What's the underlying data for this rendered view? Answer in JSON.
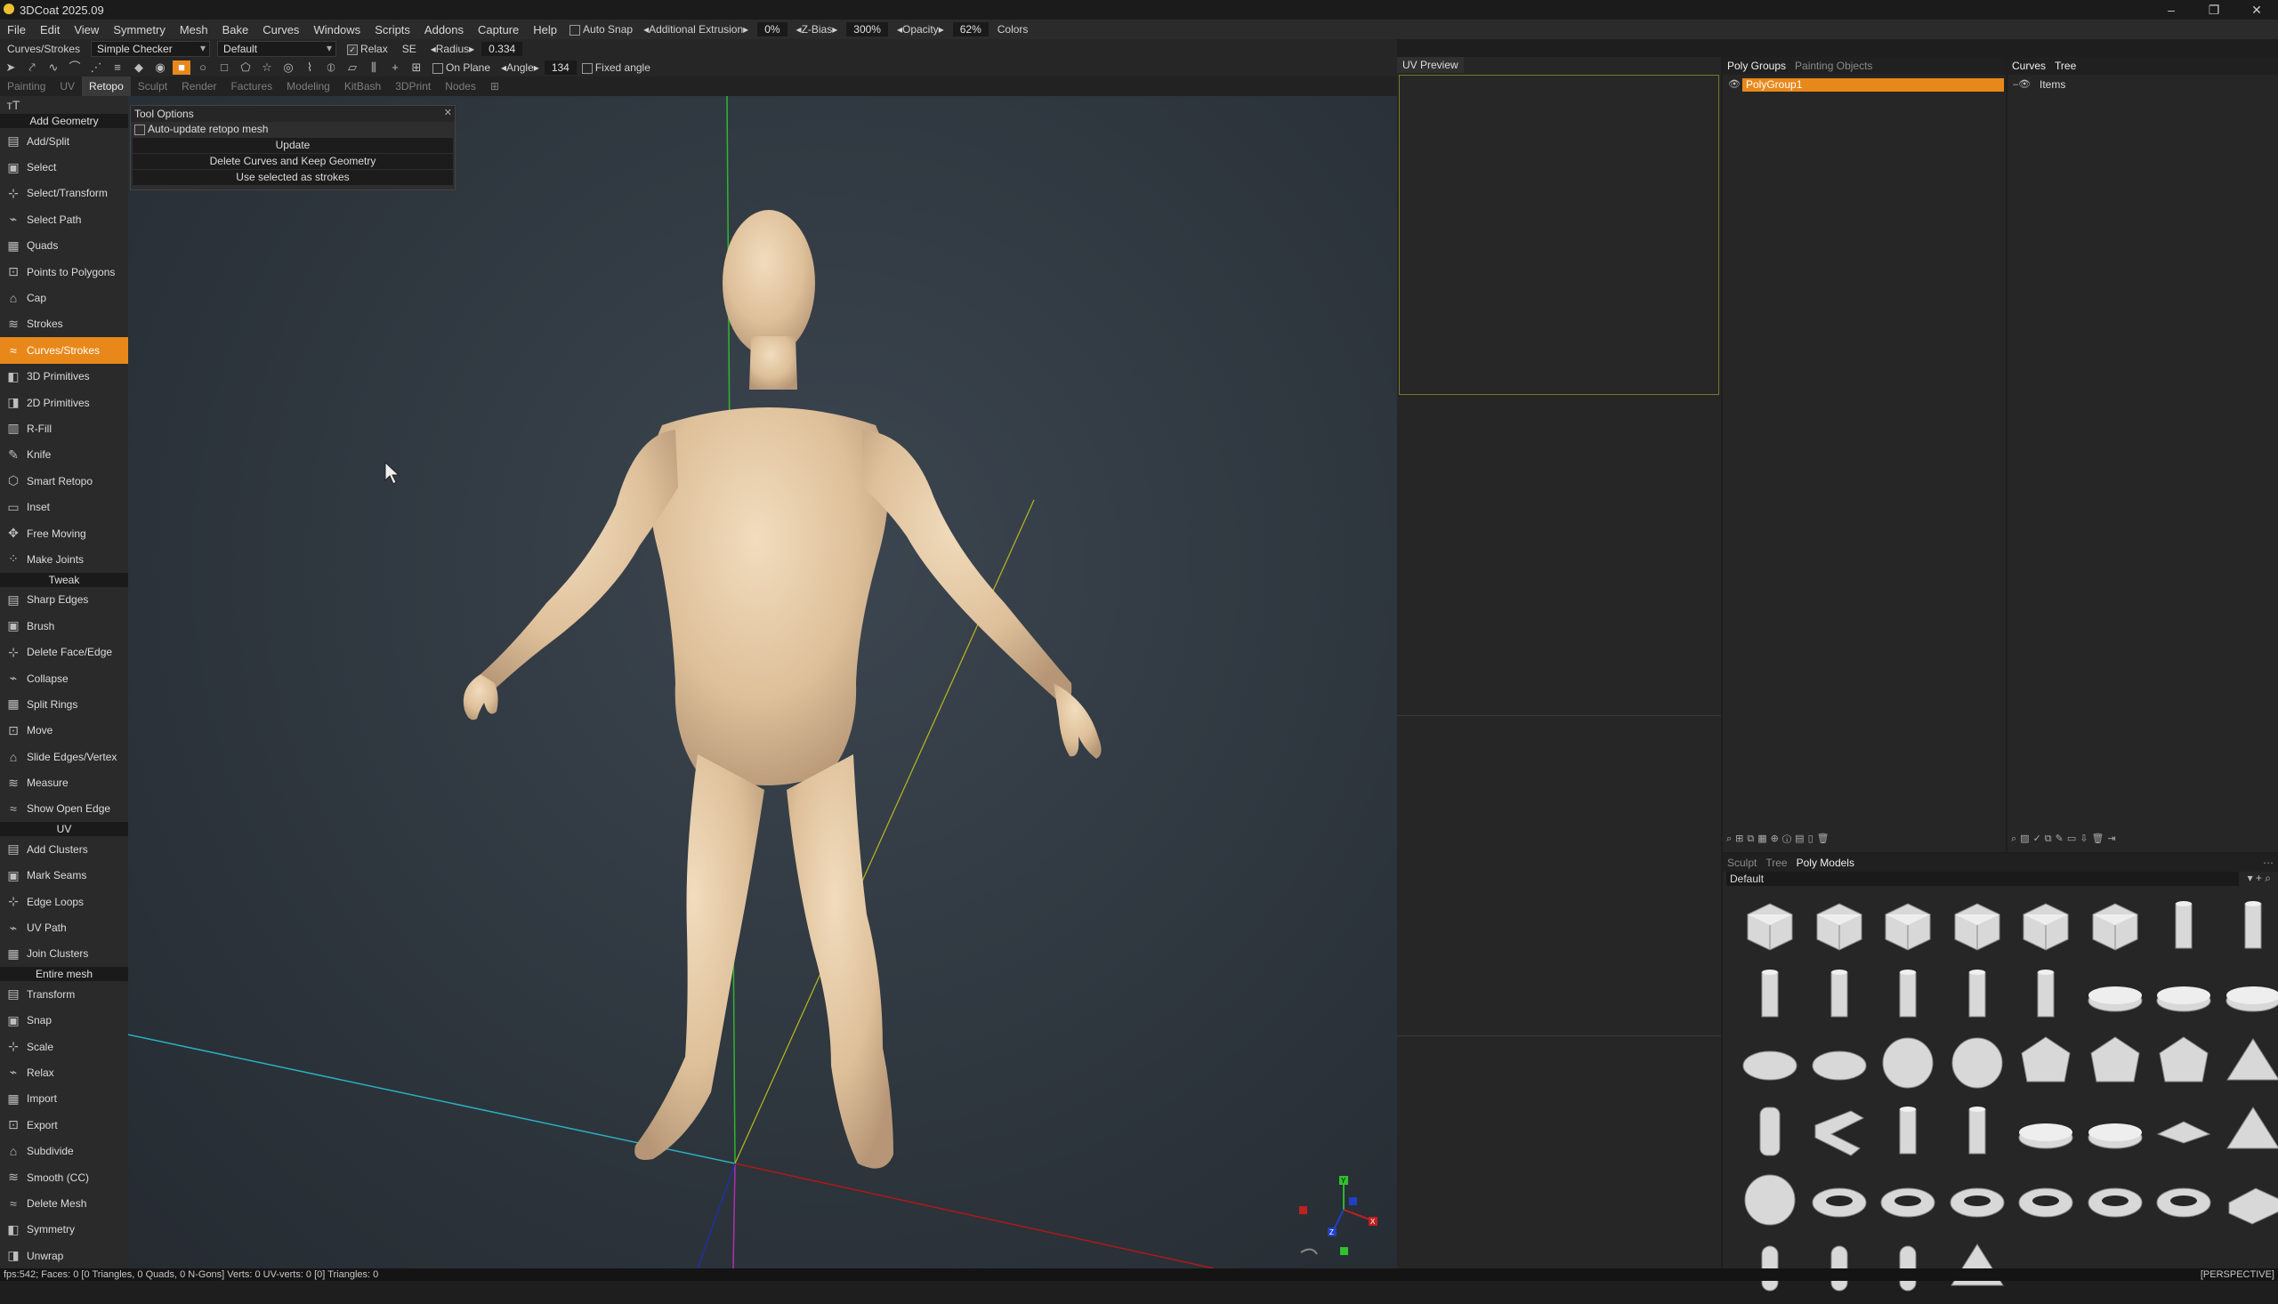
{
  "window": {
    "title": "3DCoat 2025.09",
    "controls": [
      "–",
      "❐",
      "✕"
    ]
  },
  "menu": [
    "File",
    "Edit",
    "View",
    "Symmetry",
    "Mesh",
    "Bake",
    "Curves",
    "Windows",
    "Scripts",
    "Addons",
    "Capture",
    "Help"
  ],
  "menu_controls": {
    "auto_snap": "Auto Snap",
    "additional_extrusion": "Additional Extrusion",
    "extrusion_value": "0%",
    "zbias": "Z-Bias",
    "zbias_value": "300%",
    "opacity": "Opacity",
    "opacity_value": "62%",
    "colors": "Colors"
  },
  "option_bar": {
    "tool": "Curves/Strokes",
    "material": "Simple Checker",
    "preset": "Default",
    "relax": "Relax",
    "se": "SE",
    "radius": "Radius",
    "radius_value": "0.334"
  },
  "icon_bar": {
    "on_plane": "On Plane",
    "angle": "Angle",
    "angle_value": "134",
    "fixed_angle": "Fixed angle"
  },
  "rooms": [
    "Painting",
    "UV",
    "Retopo",
    "Sculpt",
    "Render",
    "Factures",
    "Modeling",
    "KitBash",
    "3DPrint",
    "Nodes"
  ],
  "active_room": "Retopo",
  "left_tools": {
    "sections": {
      "add_geometry": "Add Geometry",
      "tweak": "Tweak",
      "uv": "UV",
      "entire_mesh": "Entire mesh"
    },
    "add_geometry": [
      {
        "label": "Add/Split",
        "icon": "add-split-icon"
      },
      {
        "label": "Select",
        "icon": "select-icon"
      },
      {
        "label": "Select/Transform",
        "icon": "select-transform-icon"
      },
      {
        "label": "Select Path",
        "icon": "select-path-icon"
      },
      {
        "label": "Quads",
        "icon": "quads-icon"
      },
      {
        "label": "Points to Polygons",
        "icon": "points-to-polygons-icon"
      },
      {
        "label": "Cap",
        "icon": "cap-icon"
      },
      {
        "label": "Strokes",
        "icon": "strokes-icon"
      },
      {
        "label": "Curves/Strokes",
        "icon": "curves-strokes-icon",
        "active": true
      },
      {
        "label": "3D Primitives",
        "icon": "primitives-3d-icon"
      },
      {
        "label": "2D Primitives",
        "icon": "primitives-2d-icon"
      },
      {
        "label": "R-Fill",
        "icon": "r-fill-icon"
      },
      {
        "label": "Knife",
        "icon": "knife-icon"
      },
      {
        "label": "Smart Retopo",
        "icon": "smart-retopo-icon"
      },
      {
        "label": "Inset",
        "icon": "inset-icon"
      },
      {
        "label": "Free Moving",
        "icon": "free-moving-icon"
      },
      {
        "label": "Make Joints",
        "icon": "make-joints-icon"
      }
    ],
    "tweak": [
      {
        "label": "Sharp Edges",
        "icon": "sharp-edges-icon"
      },
      {
        "label": "Brush",
        "icon": "brush-icon"
      },
      {
        "label": "Delete Face/Edge",
        "icon": "delete-face-edge-icon"
      },
      {
        "label": "Collapse",
        "icon": "collapse-icon"
      },
      {
        "label": "Split Rings",
        "icon": "split-rings-icon"
      },
      {
        "label": "Move",
        "icon": "move-icon"
      },
      {
        "label": "Slide Edges/Vertex",
        "icon": "slide-edges-icon"
      },
      {
        "label": "Measure",
        "icon": "measure-icon"
      },
      {
        "label": "Show Open Edge",
        "icon": "show-open-edge-icon"
      }
    ],
    "uv": [
      {
        "label": "Add Clusters",
        "icon": "add-clusters-icon"
      },
      {
        "label": "Mark Seams",
        "icon": "mark-seams-icon"
      },
      {
        "label": "Edge Loops",
        "icon": "edge-loops-icon"
      },
      {
        "label": "UV Path",
        "icon": "uv-path-icon"
      },
      {
        "label": "Join Clusters",
        "icon": "join-clusters-icon"
      }
    ],
    "entire_mesh": [
      {
        "label": "Transform",
        "icon": "transform-icon"
      },
      {
        "label": "Snap",
        "icon": "snap-icon"
      },
      {
        "label": "Scale",
        "icon": "scale-icon"
      },
      {
        "label": "Relax",
        "icon": "relax-icon"
      },
      {
        "label": "Import",
        "icon": "import-icon"
      },
      {
        "label": "Export",
        "icon": "export-icon"
      },
      {
        "label": "Subdivide",
        "icon": "subdivide-icon"
      },
      {
        "label": "Smooth (CC)",
        "icon": "smooth-cc-icon"
      },
      {
        "label": "Delete Mesh",
        "icon": "delete-mesh-icon"
      },
      {
        "label": "Symmetry",
        "icon": "symmetry-icon"
      },
      {
        "label": "Unwrap",
        "icon": "unwrap-icon"
      }
    ]
  },
  "tool_options": {
    "title": "Tool Options",
    "auto_update": "Auto-update retopo mesh",
    "update": "Update",
    "delete_curves": "Delete Curves and Keep Geometry",
    "use_selected": "Use selected as strokes"
  },
  "uv_panel": {
    "tab": "UV Preview"
  },
  "poly_panel": {
    "tabs": [
      "Poly Groups",
      "Painting Objects"
    ],
    "groups": [
      "PolyGroup1"
    ]
  },
  "curves_panel": {
    "tabs": [
      "Curves",
      "Tree"
    ],
    "items": [
      "Items"
    ]
  },
  "models_panel": {
    "tabs": [
      "Sculpt",
      "Tree",
      "Poly Models"
    ],
    "preset": "Default"
  },
  "status": {
    "text": "fps:542;      Faces: 0  [0  Triangles, 0  Quads, 0  N-Gons]  Verts: 0    UV-verts: 0  [0]  Triangles: 0",
    "view": "[PERSPECTIVE]"
  },
  "colors": {
    "accent": "#e8881a",
    "skin": "#e3c9a6",
    "axis_x": "#c02020",
    "axis_y": "#30c030",
    "axis_z": "#2040c0"
  }
}
